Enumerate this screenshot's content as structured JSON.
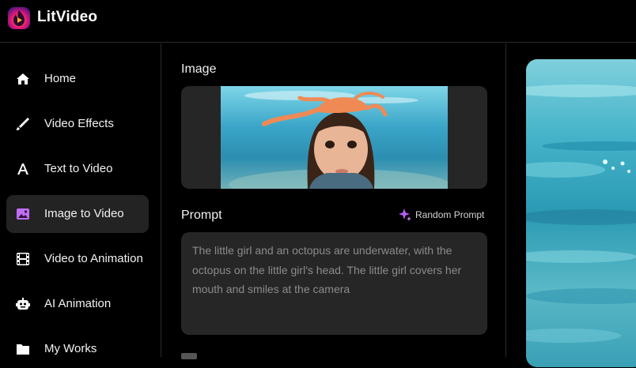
{
  "app": {
    "name": "LitVideo"
  },
  "sidebar": {
    "items": [
      {
        "label": "Home",
        "icon": "home-icon",
        "active": false
      },
      {
        "label": "Video Effects",
        "icon": "brush-icon",
        "active": false
      },
      {
        "label": "Text to Video",
        "icon": "text-icon",
        "active": false
      },
      {
        "label": "Image to Video",
        "icon": "image-icon",
        "active": true
      },
      {
        "label": "Video to Animation",
        "icon": "film-icon",
        "active": false
      },
      {
        "label": "AI Animation",
        "icon": "robot-icon",
        "active": false
      },
      {
        "label": "My Works",
        "icon": "folder-icon",
        "active": false
      }
    ]
  },
  "panel": {
    "image_label": "Image",
    "prompt_label": "Prompt",
    "random_prompt_label": "Random Prompt",
    "prompt_placeholder": "The little girl and an octopus are underwater, with the octopus on the little girl's head. The little girl covers her mouth and smiles at the camera"
  },
  "colors": {
    "accent": "#a855f7",
    "active_bg": "#232323",
    "panel_bg": "#262626"
  }
}
